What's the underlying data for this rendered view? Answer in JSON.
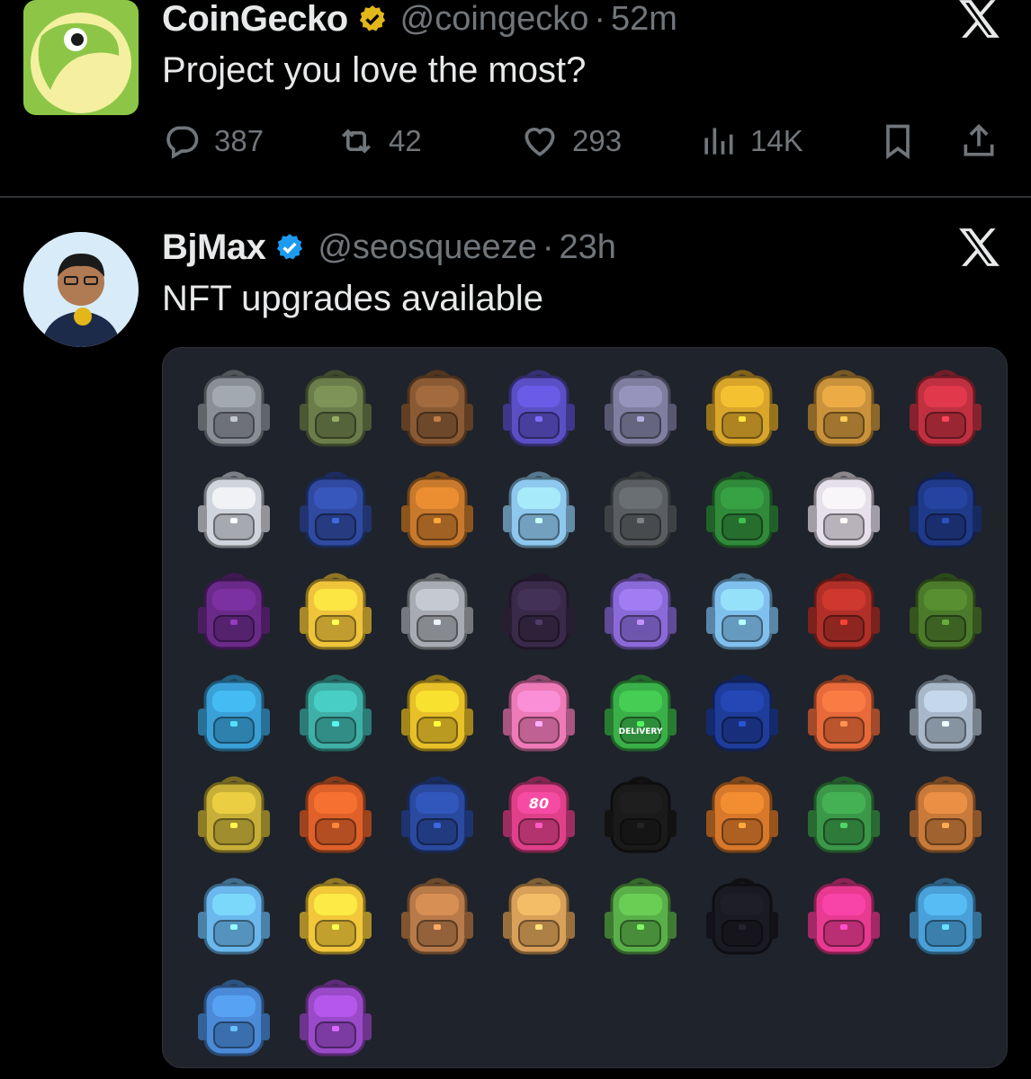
{
  "tweets": [
    {
      "author": "CoinGecko",
      "handle": "@coingecko",
      "separator": "·",
      "time": "52m",
      "text": "Project you love the most?",
      "badge": "gold-verified-badge",
      "stats": {
        "replies": "387",
        "reposts": "42",
        "likes": "293",
        "views": "14K"
      }
    },
    {
      "author": "BjMax",
      "handle": "@seosqueeze",
      "separator": "·",
      "time": "23h",
      "text": "NFT upgrades available",
      "badge": "blue-verified-badge"
    }
  ],
  "media": {
    "item_count": 50,
    "item_labels": {
      "delivery": "DELIVERY",
      "number": "80"
    },
    "colors": [
      "#8a8f96",
      "#6b7d4a",
      "#8a5a34",
      "#5a4fc4",
      "#7f7ea0",
      "#d9a52a",
      "#c9923b",
      "#c03040",
      "#d0d4dc",
      "#2f4aa0",
      "#c8792b",
      "#8ec8ee",
      "#5a5e62",
      "#2f8a3a",
      "#e6e0ea",
      "#203a8a",
      "#6a2a8a",
      "#f0c43a",
      "#a8acb2",
      "#3a2a4a",
      "#8a6ad8",
      "#7fc0ee",
      "#b03028",
      "#4a7a2a",
      "#3aa0d8",
      "#3fb0a8",
      "#e8c028",
      "#ef7ab8",
      "#3ab048",
      "#1e3c9a",
      "#e86a3a",
      "#a8b8c8",
      "#c8b038",
      "#e0602a",
      "#2a4aa0",
      "#e0408a",
      "#1a1a1a",
      "#d8782a",
      "#3a9848",
      "#c87a3a",
      "#6ab8ee",
      "#f2c83a",
      "#b87a48",
      "#d8a058",
      "#5ab048",
      "#1a1a22",
      "#e83a90",
      "#4aa0d8",
      "#4a8ad8",
      "#9a4ac8"
    ]
  }
}
